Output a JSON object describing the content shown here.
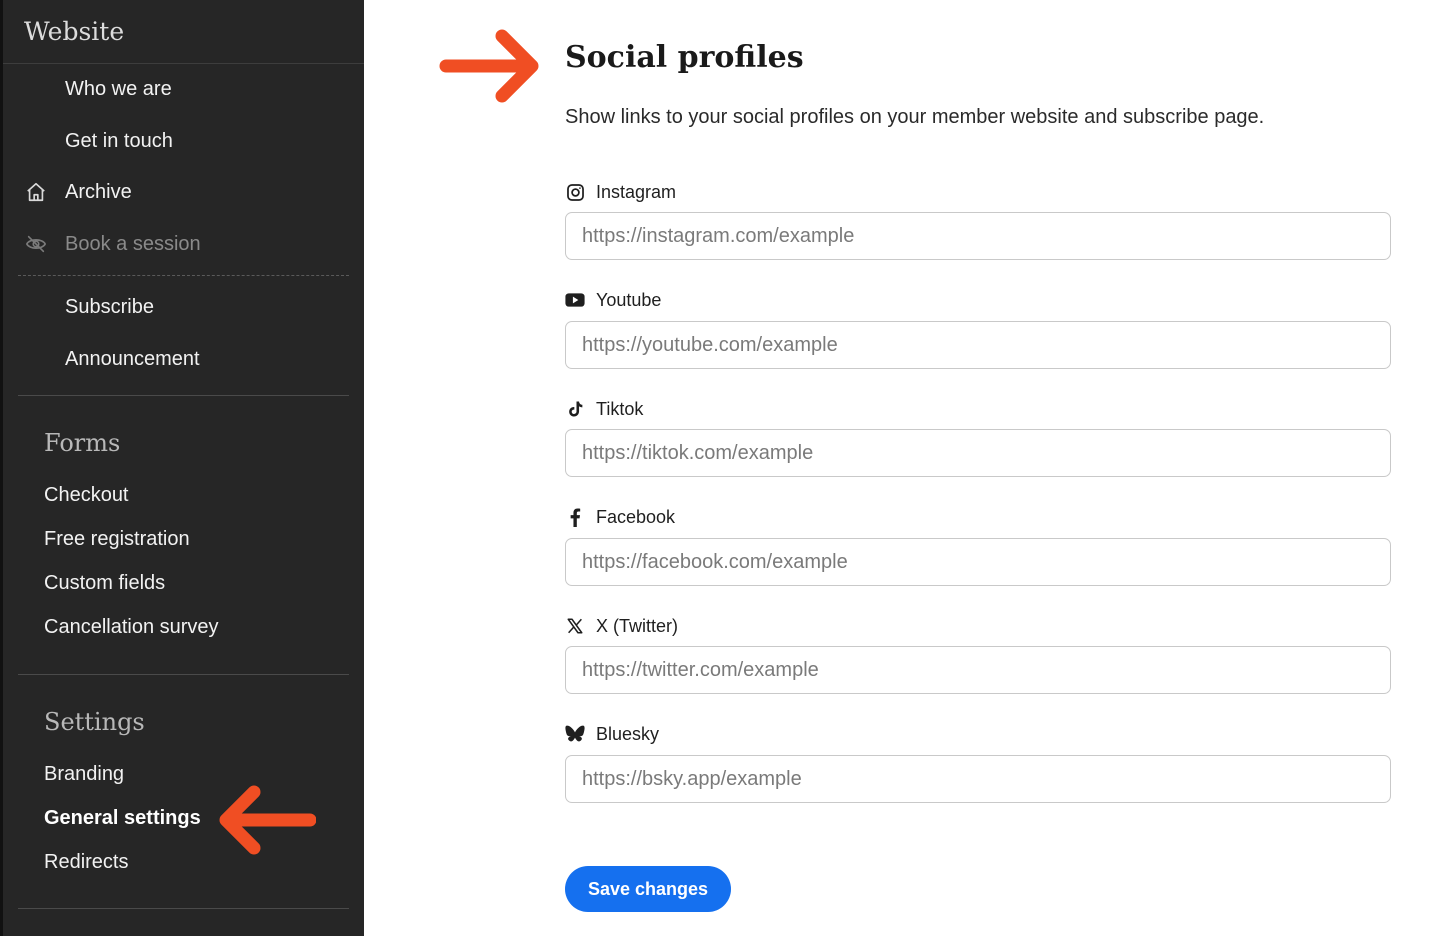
{
  "sidebar": {
    "header": "Website",
    "items": [
      {
        "label": "Who we are"
      },
      {
        "label": "Get in touch"
      },
      {
        "label": "Archive",
        "icon": "home-icon"
      },
      {
        "label": "Book a session",
        "icon": "eye-off-icon"
      },
      {
        "label": "Subscribe"
      },
      {
        "label": "Announcement"
      }
    ],
    "forms": {
      "title": "Forms",
      "links": [
        "Checkout",
        "Free registration",
        "Custom fields",
        "Cancellation survey"
      ]
    },
    "settings": {
      "title": "Settings",
      "links": [
        "Branding",
        "General settings",
        "Redirects"
      ],
      "active": "General settings"
    }
  },
  "main": {
    "title": "Social profiles",
    "subtitle": "Show links to your social profiles on your member website and subscribe page.",
    "fields": [
      {
        "label": "Instagram",
        "icon": "instagram-icon",
        "placeholder": "https://instagram.com/example",
        "value": ""
      },
      {
        "label": "Youtube",
        "icon": "youtube-icon",
        "placeholder": "https://youtube.com/example",
        "value": ""
      },
      {
        "label": "Tiktok",
        "icon": "tiktok-icon",
        "placeholder": "https://tiktok.com/example",
        "value": ""
      },
      {
        "label": "Facebook",
        "icon": "facebook-icon",
        "placeholder": "https://facebook.com/example",
        "value": ""
      },
      {
        "label": "X (Twitter)",
        "icon": "x-twitter-icon",
        "placeholder": "https://twitter.com/example",
        "value": ""
      },
      {
        "label": "Bluesky",
        "icon": "bluesky-icon",
        "placeholder": "https://bsky.app/example",
        "value": ""
      }
    ],
    "save_label": "Save changes"
  },
  "colors": {
    "sidebar_bg": "#262626",
    "accent_button": "#1570ef",
    "annotation_arrow": "#f04e23"
  }
}
